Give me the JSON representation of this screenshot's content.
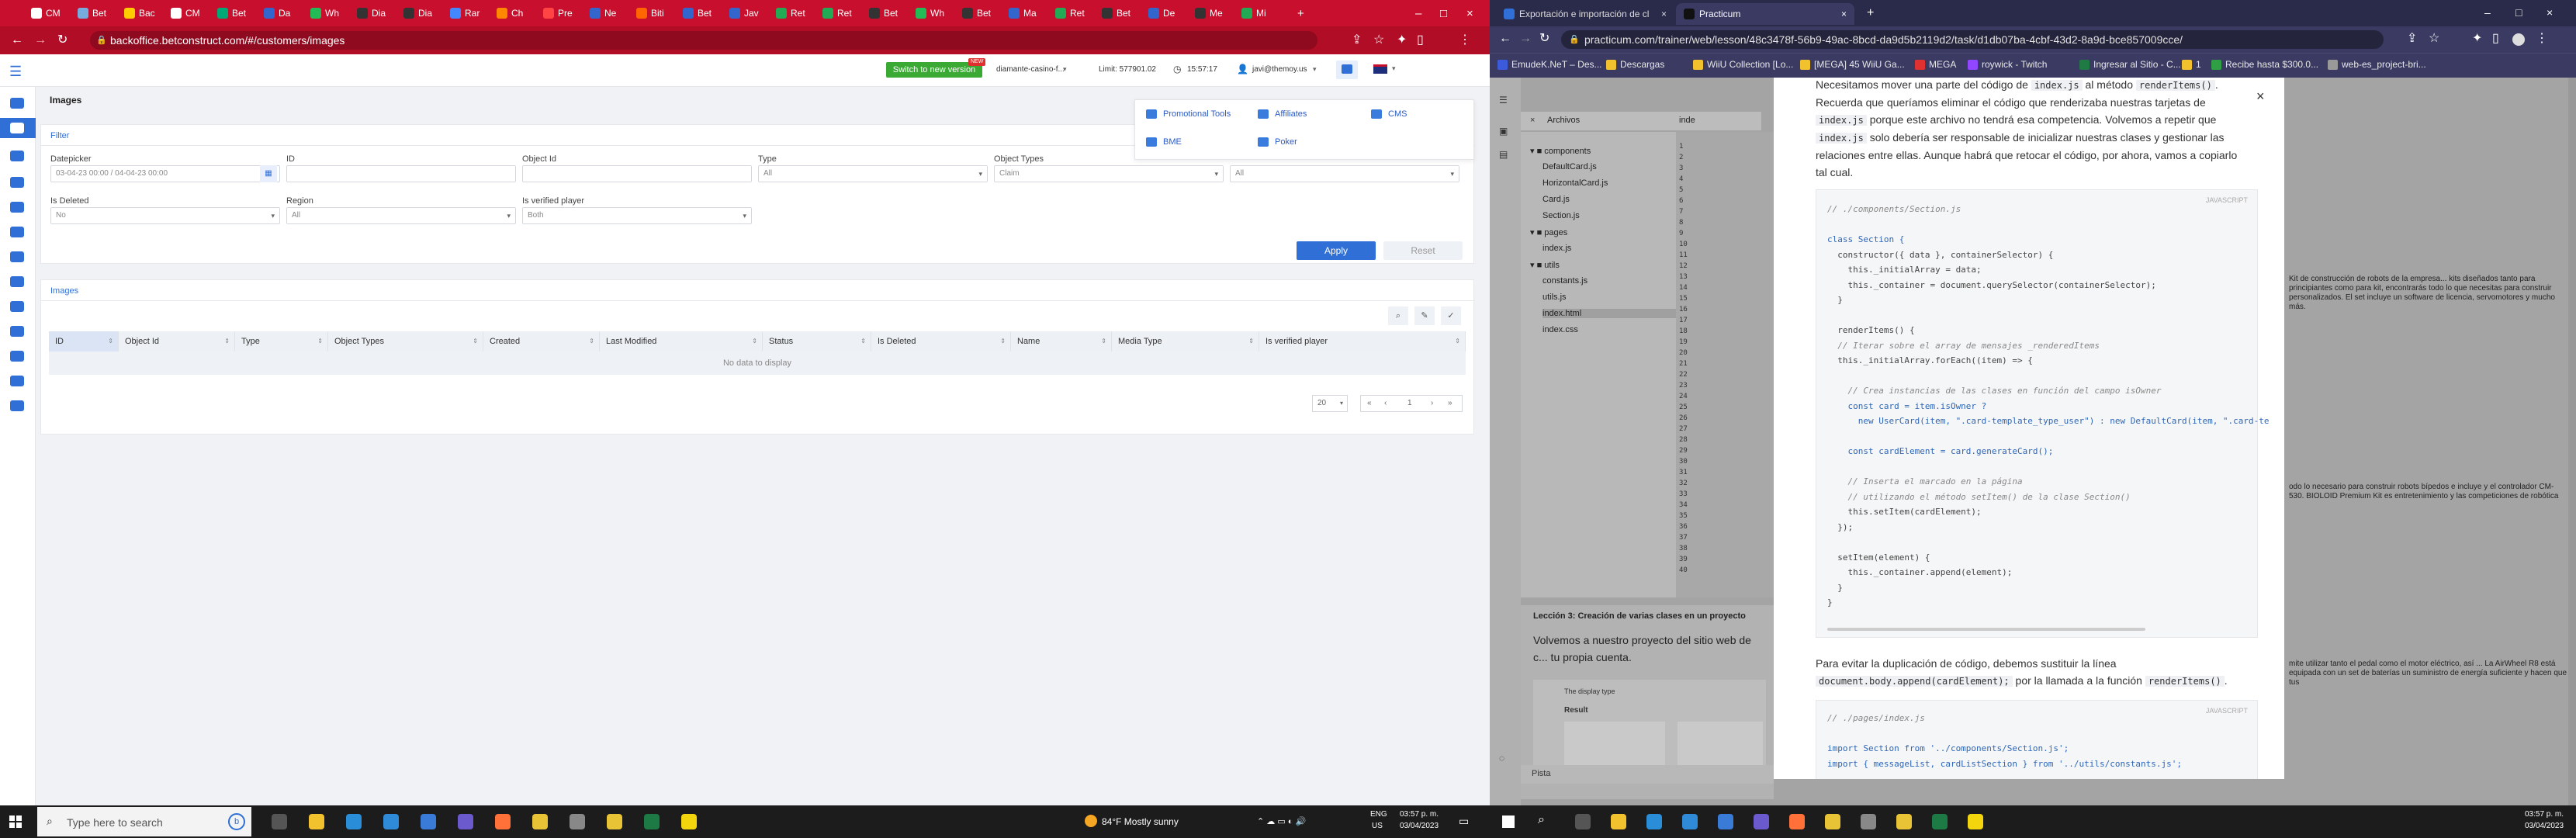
{
  "left_browser": {
    "tabs": [
      "CM",
      "Bet",
      "Bac",
      "CM",
      "Bet",
      "Da",
      "Wh",
      "Dia",
      "Dia",
      "Rar",
      "Ch",
      "Pre",
      "Ne",
      "Biti",
      "Bet",
      "Jav",
      "Ret",
      "Ret",
      "Bet",
      "Wh",
      "Bet",
      "Ma",
      "Ret",
      "Bet",
      "De",
      "Me",
      "Mi"
    ],
    "url": "backoffice.betconstruct.com/#/customers/images"
  },
  "app_header": {
    "switch_button": "Switch to new version",
    "new_badge": "NEW",
    "partner": "diamante-casino-f...",
    "limit": "Limit: 577901.02",
    "time": "15:57:17",
    "user": "javi@themoy.us"
  },
  "page": {
    "title": "Images",
    "filter_header": "Filter",
    "filters": {
      "datepicker_label": "Datepicker",
      "datepicker_value": "03-04-23 00:00 / 04-04-23 00:00",
      "id_label": "ID",
      "object_id_label": "Object Id",
      "type_label": "Type",
      "type_value": "All",
      "object_types_label": "Object Types",
      "object_types_value": "Claim",
      "extra_value": "All",
      "is_deleted_label": "Is Deleted",
      "is_deleted_value": "No",
      "region_label": "Region",
      "region_value": "All",
      "verified_label": "Is verified player",
      "verified_value": "Both"
    },
    "apply_label": "Apply",
    "reset_label": "Reset",
    "images_header": "Images",
    "columns": [
      "ID",
      "Object Id",
      "Type",
      "Object Types",
      "Created",
      "Last Modified",
      "Status",
      "Is Deleted",
      "Name",
      "Media Type",
      "Is verified player"
    ],
    "empty_text": "No data to display",
    "page_size": "20",
    "page_number": "1"
  },
  "dropdown_menu": {
    "items": [
      "Promotional Tools",
      "Affiliates",
      "CMS",
      "BME",
      "Poker"
    ]
  },
  "right_browser": {
    "tabs": [
      "Exportación e importación de cl",
      "Practicum"
    ],
    "url": "practicum.com/trainer/web/lesson/48c3478f-56b9-49ac-8bcd-da9d5b2119d2/task/d1db07ba-4cbf-43d2-8a9d-bce857009cce/",
    "bookmarks": [
      "EmudeK.NeT – Des...",
      "Descargas",
      "WiiU Collection [Lo...",
      "[MEGA] 45 WiiU Ga...",
      "MEGA",
      "roywick - Twitch",
      "Ingresar al Sitio - C...",
      "1",
      "Recibe hasta $300.0...",
      "web-es_project-bri..."
    ]
  },
  "ide": {
    "panel_title": "Archivos",
    "tab_index": "inde",
    "tree": [
      "components",
      "DefaultCard.js",
      "HorizontalCard.js",
      "Card.js",
      "Section.js",
      "pages",
      "index.js",
      "utils",
      "constants.js",
      "utils.js",
      "index.html",
      "index.css"
    ],
    "lesson_heading": "Lección 3: Creación de varias clases en un proyecto",
    "lesson_text": "Volvemos a nuestro proyecto del sitio web de c... tu propia cuenta.",
    "display_type_label": "The display type",
    "result_label": "Result",
    "file_label": "Pista",
    "bg_text_1": "Kit de construcción de robots de la empresa... kits diseñados tanto para principiantes como para kit, encontrarás todo lo que necesitas para construir personalizados. El set incluye un software de licencia, servomotores y mucho más.",
    "bg_text_2": "odo lo necesario para construir robots bípedos e incluye y el controlador CM-530. BIOLOID Premium Kit es entretenimiento y las competiciones de robótica",
    "bg_text_3": "mite utilizar tanto el pedal como el motor eléctrico, así ... La AirWheel R8 está equipada con un set de baterías un suministro de energía suficiente y hacen que tus"
  },
  "modal": {
    "para1_a": "Necesitamos mover una parte del código de",
    "para1_code1": "index.js",
    "para1_b": "al método",
    "para1_code2": "renderItems()",
    "para1_c": ". Recuerda que queríamos eliminar el código que renderizaba nuestras tarjetas de",
    "para1_code3": "index.js",
    "para1_d": "porque este archivo no tendrá esa competencia. Volvemos a repetir que",
    "para1_code4": "index.js",
    "para1_e": "solo debería ser responsable de inicializar nuestras clases y gestionar las relaciones entre ellas. Aunque habrá que retocar el código, por ahora, vamos a copiarlo tal cual.",
    "code1_lang": "JAVASCRIPT",
    "code1": [
      "// ./components/Section.js",
      "",
      "class Section {",
      "  constructor({ data }, containerSelector) {",
      "    this._initialArray = data;",
      "    this._container = document.querySelector(containerSelector);",
      "  }",
      "",
      "  renderItems() {",
      "  // Iterar sobre el array de mensajes _renderedItems",
      "  this._initialArray.forEach((item) => {",
      "",
      "    // Crea instancias de las clases en función del campo isOwner",
      "    const card = item.isOwner ?",
      "      new UserCard(item, \".card-template_type_user\") : new DefaultCard(item, \".card-te",
      "",
      "    const cardElement = card.generateCard();",
      "",
      "    // Inserta el marcado en la página",
      "    // utilizando el método setItem() de la clase Section()",
      "    this.setItem(cardElement);",
      "  });",
      "",
      "  setItem(element) {",
      "    this._container.append(element);",
      "  }",
      "}"
    ],
    "para2_a": "Para evitar la duplicación de código, debemos sustituir la línea",
    "para2_code": "document.body.append(cardElement);",
    "para2_b": "por la llamada a la función",
    "para2_code2": "renderItems()",
    "para2_c": ".",
    "code2_lang": "JAVASCRIPT",
    "code2": [
      "// ./pages/index.js",
      "",
      "import Section from '../components/Section.js';",
      "import { messageList, cardListSection } from '../utils/constants.js';"
    ]
  },
  "taskbar": {
    "search_placeholder": "Type here to search",
    "weather": "84°F  Mostly sunny",
    "lang1": "ENG",
    "lang2": "US",
    "time_left": "03:57 p. m.",
    "date_left": "03/04/2023",
    "time_right": "03:57 p. m.",
    "date_right": "03/04/2023"
  },
  "colors": {
    "left_chrome": "#c8102e",
    "right_chrome": "#3a3a63",
    "accent_blue": "#2f6fd6",
    "switch_green": "#3aaa35"
  }
}
